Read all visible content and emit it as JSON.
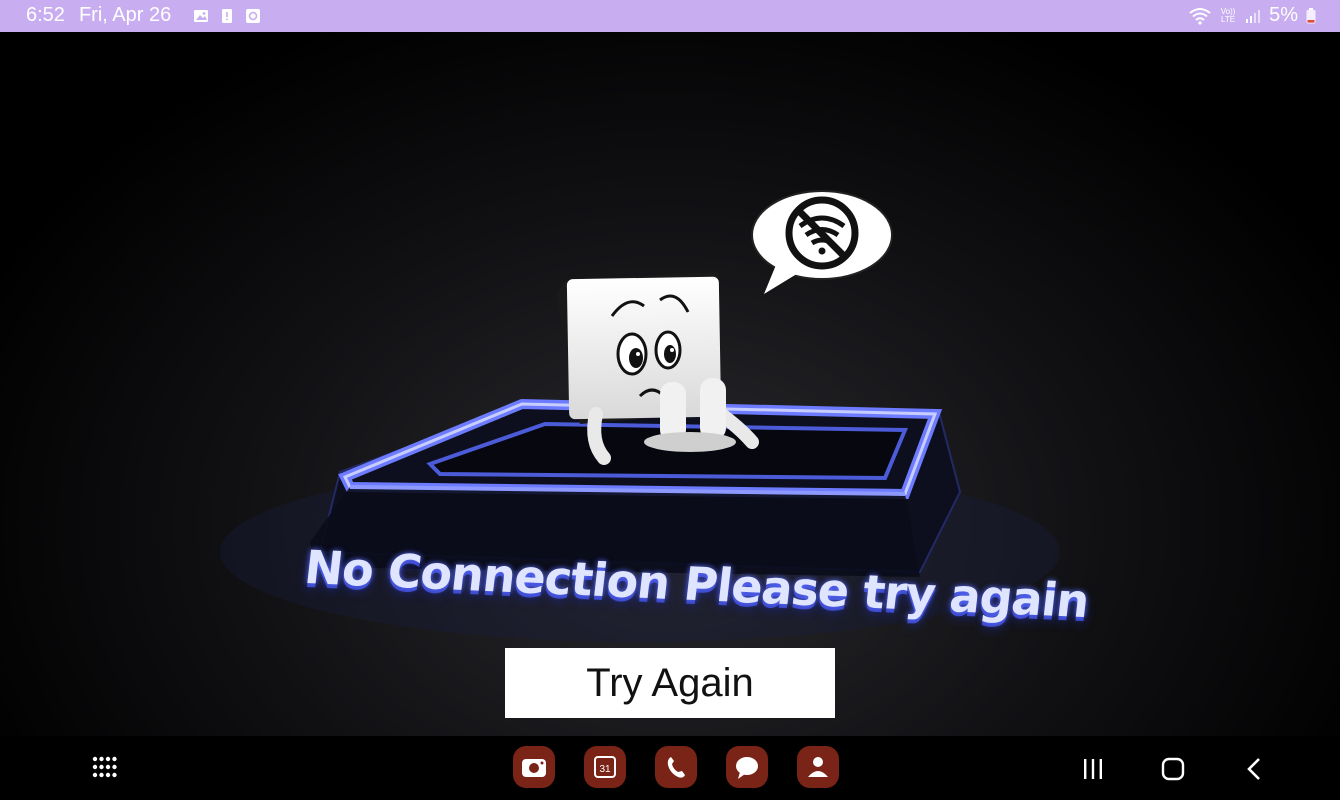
{
  "status_bar": {
    "time": "6:52",
    "date": "Fri, Apr 26",
    "battery": "5%",
    "network": "Vo)) LTE",
    "notification_icons": [
      "gallery-icon",
      "alert-icon",
      "screenshot-icon"
    ]
  },
  "main": {
    "message": "No Connection Please try again",
    "try_again_label": "Try Again"
  },
  "dock": {
    "apps": [
      "camera-app",
      "calendar-app",
      "phone-app",
      "messages-app",
      "contacts-app"
    ],
    "calendar_day": "31"
  },
  "colors": {
    "status_bar": "#c8aef0",
    "accent_blue": "#4a5cff",
    "dock_app": "#7a2418"
  }
}
